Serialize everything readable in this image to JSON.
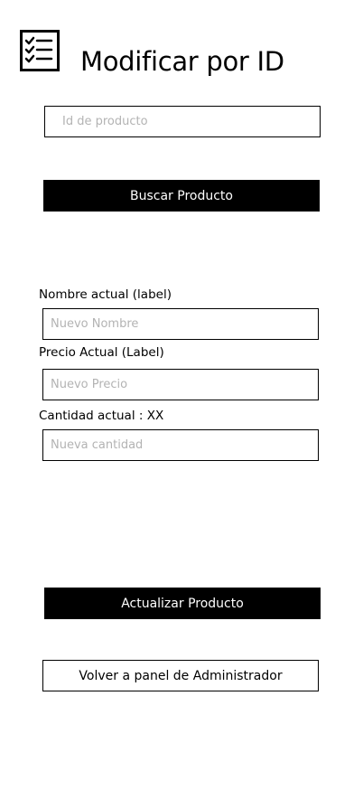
{
  "header": {
    "icon": "checklist-icon",
    "title": "Modificar por ID"
  },
  "search": {
    "id_placeholder": "Id de producto",
    "button_label": "Buscar Producto"
  },
  "form": {
    "name_label": "Nombre actual (label)",
    "name_placeholder": "Nuevo Nombre",
    "price_label": "Precio Actual (Label)",
    "price_placeholder": "Nuevo Precio",
    "quantity_label": "Cantidad actual : XX",
    "quantity_placeholder": "Nueva cantidad"
  },
  "actions": {
    "update_label": "Actualizar Producto",
    "back_label": "Volver a panel de Administrador"
  },
  "colors": {
    "primary": "#000000",
    "background": "#ffffff",
    "placeholder": "#b3b3b3"
  }
}
